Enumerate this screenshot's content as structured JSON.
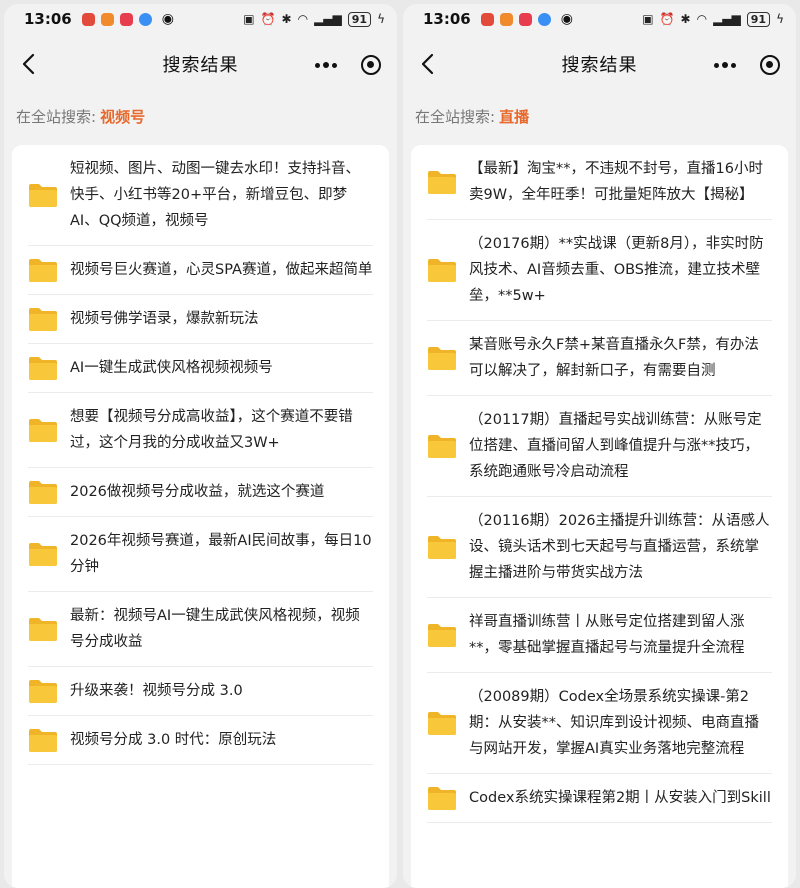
{
  "status": {
    "time": "13:06",
    "battery": "91"
  },
  "nav": {
    "title": "搜索结果"
  },
  "left": {
    "scope_label": "在全站搜索:",
    "keyword": "视频号",
    "results": [
      {
        "title": "短视频、图片、动图一键去水印！支持抖音、快手、小红书等20+平台，新增豆包、即梦AI、QQ频道，视频号"
      },
      {
        "title": "视频号巨火赛道，心灵SPA赛道，做起来超简单"
      },
      {
        "title": "视频号佛学语录，爆款新玩法"
      },
      {
        "title": "AI一键生成武侠风格视频视频号"
      },
      {
        "title": "想要【视频号分成高收益】，这个赛道不要错过，这个月我的分成收益又3W+"
      },
      {
        "title": "2026做视频号分成收益，就选这个赛道"
      },
      {
        "title": "2026年视频号赛道，最新AI民间故事，每日10分钟"
      },
      {
        "title": "最新：视频号AI一键生成武侠风格视频，视频号分成收益"
      },
      {
        "title": "升级来袭！视频号分成 3.0"
      },
      {
        "title": "视频号分成 3.0 时代：原创玩法"
      }
    ]
  },
  "right": {
    "scope_label": "在全站搜索:",
    "keyword": "直播",
    "results": [
      {
        "title": "【最新】淘宝**，不违规不封号，直播16小时卖9W，全年旺季！可批量矩阵放大【揭秘】"
      },
      {
        "title": "（20176期）**实战课（更新8月），非实时防风技术、AI音频去重、OBS推流，建立技术壁垒，**5w+"
      },
      {
        "title": "某音账号永久F禁+某音直播永久F禁，有办法可以解决了，解封新口子，有需要自测"
      },
      {
        "title": "（20117期）直播起号实战训练营：从账号定位搭建、直播间留人到峰值提升与涨**技巧，系统跑通账号冷启动流程"
      },
      {
        "title": "（20116期）2026主播提升训练营：从语感人设、镜头话术到七天起号与直播运营，系统掌握主播进阶与带货实战方法"
      },
      {
        "title": "祥哥直播训练营丨从账号定位搭建到留人涨**，零基础掌握直播起号与流量提升全流程"
      },
      {
        "title": "（20089期）Codex全场景系统实操课-第2期：从安装**、知识库到设计视频、电商直播与网站开发，掌握AI真实业务落地完整流程"
      },
      {
        "title": "Codex系统实操课程第2期丨从安装入门到Skill"
      }
    ]
  },
  "icons": {
    "back": "chevron-left-icon",
    "more": "more-dots-icon",
    "close": "target-circle-icon",
    "folder": "folder-icon"
  },
  "colors": {
    "keyword": "#e8692c",
    "folder": "#f8c83a"
  }
}
